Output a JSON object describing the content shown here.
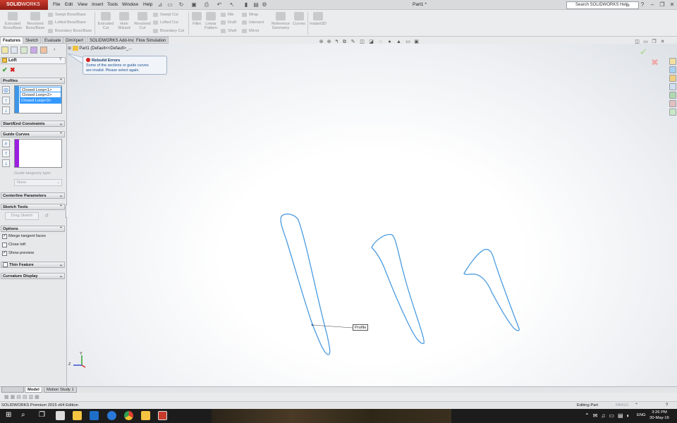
{
  "app": {
    "logo_brand": "SOLID",
    "logo_rest": "WORKS",
    "doc_title": "Part1 *",
    "search_placeholder": "Search SOLIDWORKS Help"
  },
  "menu": [
    "File",
    "Edit",
    "View",
    "Insert",
    "Tools",
    "Window",
    "Help"
  ],
  "ribbon": {
    "extruded_boss": "Extruded\nBoss/Base",
    "revolved_boss": "Revolved\nBoss/Base",
    "swept_boss": "Swept Boss/Base",
    "lofted_boss": "Lofted Boss/Base",
    "boundary_boss": "Boundary Boss/Base",
    "extruded_cut": "Extruded\nCut",
    "hole_wizard": "Hole\nWizard",
    "revolved_cut": "Revolved\nCut",
    "swept_cut": "Swept Cut",
    "lofted_cut": "Lofted Cut",
    "boundary_cut": "Boundary Cut",
    "fillet": "Fillet",
    "linear_pattern": "Linear\nPattern",
    "rib": "Rib",
    "draft": "Draft",
    "shell": "Shell",
    "wrap": "Wrap",
    "intersect": "Intersect",
    "mirror": "Mirror",
    "reference_geometry": "Reference\nGeometry",
    "curves": "Curves",
    "instant3d": "Instant3D"
  },
  "tabs": [
    "Features",
    "Sketch",
    "Evaluate",
    "DimXpert",
    "SOLIDWORKS Add-Ins",
    "Flow Simulation"
  ],
  "panel": {
    "title": "Loft",
    "profiles_header": "Profiles",
    "profiles": [
      "Closed Loop<1>",
      "Closed Loop<2>",
      "Closed Loop<3>"
    ],
    "start_end_header": "Start/End Constraints",
    "guide_curves_header": "Guide Curves",
    "guide_tangency": "Guide tangency type:",
    "guide_none": "None",
    "centerline_header": "Centerline Parameters",
    "sketch_tools_header": "Sketch Tools",
    "drag_sketch": "Drag Sketch",
    "options_header": "Options",
    "merge_tangent": "Merge tangent faces",
    "close_loft": "Close loft",
    "show_preview": "Show preview",
    "thin_feature": "Thin Feature",
    "curvature_display": "Curvature Display"
  },
  "options_state": {
    "merge_tangent": true,
    "close_loft": false,
    "show_preview": true
  },
  "viewport": {
    "tree_label": "Part1  (Default<<Default>_...",
    "tooltip_title": "Rebuild Errors",
    "tooltip_body_1": "Some of the sections or guide curves",
    "tooltip_body_2": "are invalid. Please select again.",
    "profile_label": "Profile",
    "axis_y": "Y",
    "axis_z": "Z"
  },
  "bottom_tabs": [
    "Model",
    "Motion Study 1"
  ],
  "status": {
    "edition": "SOLIDWORKS Premium 2015 x64 Edition",
    "mode": "Editing Part",
    "units": "MMGS"
  },
  "clock": {
    "time": "3:26 PM",
    "date": "30-May-16"
  },
  "tray_lang": "ENG",
  "colors": {
    "accent": "#3399ff",
    "sketch": "#4a9be0",
    "error": "#d42020"
  }
}
